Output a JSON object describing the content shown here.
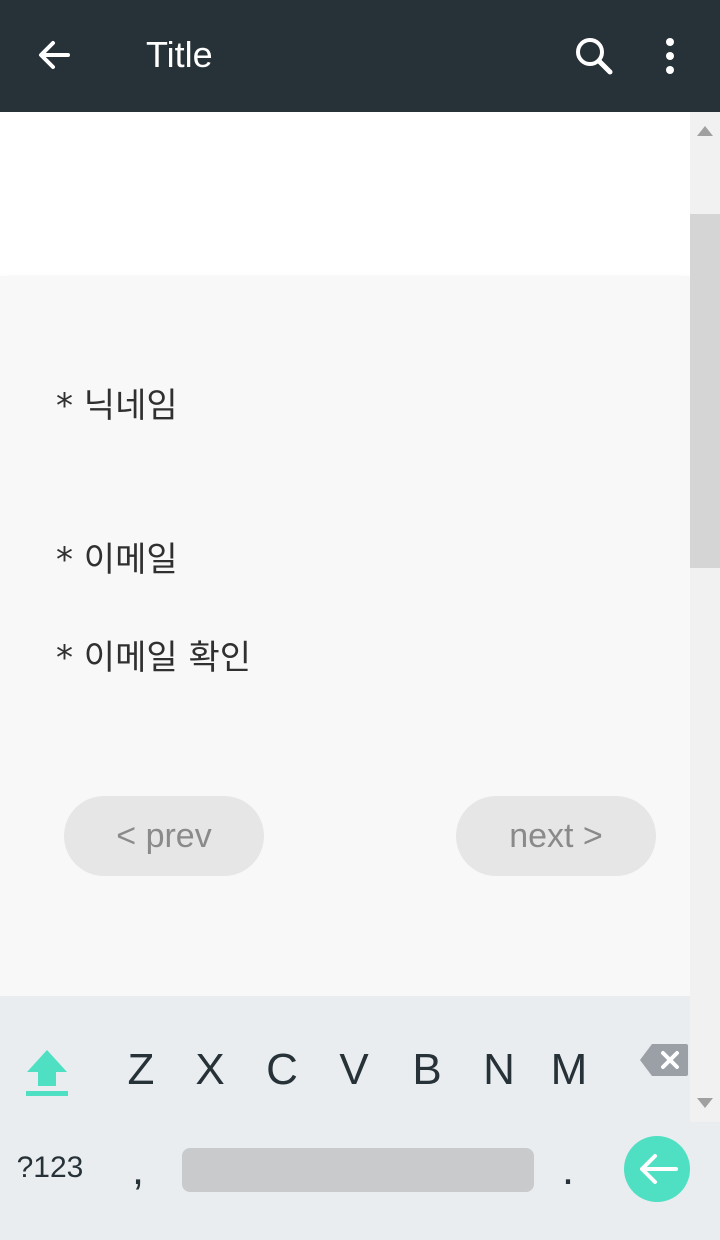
{
  "appbar": {
    "title": "Title",
    "back_icon": "arrow-back-icon",
    "search_icon": "search-icon",
    "more_icon": "more-vert-icon"
  },
  "form": {
    "fields": [
      {
        "label": "* 닉네임"
      },
      {
        "label": "* 이메일"
      },
      {
        "label": "* 이메일 확인"
      }
    ],
    "prev_label": "< prev",
    "next_label": "next >"
  },
  "keyboard": {
    "row_letters": [
      "Z",
      "X",
      "C",
      "V",
      "B",
      "N",
      "M"
    ],
    "symbols_label": "?123",
    "comma": ",",
    "period": ".",
    "accent_color": "#4fdfc2",
    "shift_icon": "shift-arrow-icon",
    "backspace_icon": "backspace-icon",
    "enter_icon": "enter-arrow-icon"
  },
  "colors": {
    "appbar": "#263238",
    "form_bg": "#f8f8f8",
    "button_bg": "#e6e6e6",
    "keyboard_bg": "#e9edf0"
  }
}
